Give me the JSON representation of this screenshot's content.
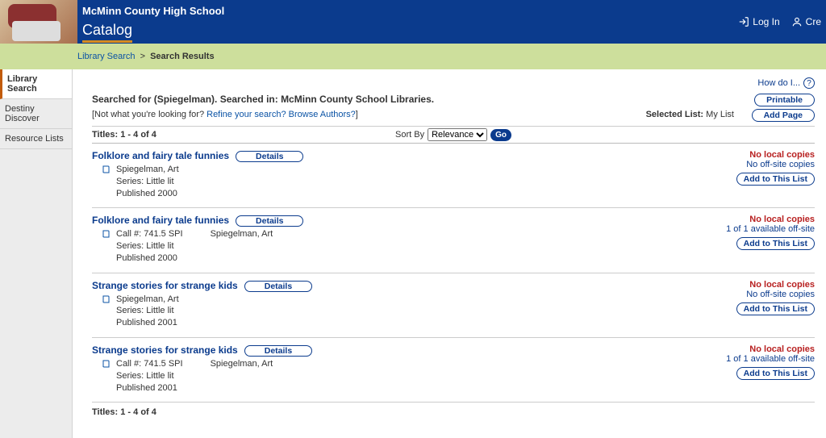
{
  "header": {
    "school_name": "McMinn County High School",
    "catalog_label": "Catalog",
    "login_label": "Log In",
    "create_label": "Cre"
  },
  "breadcrumb": {
    "library_search": "Library Search",
    "search_results": "Search Results"
  },
  "left_nav": {
    "items": [
      {
        "label": "Library Search",
        "active": true
      },
      {
        "label": "Destiny Discover",
        "active": false
      },
      {
        "label": "Resource Lists",
        "active": false
      }
    ]
  },
  "howto_label": "How do I...",
  "search_summary": "Searched for (Spiegelman). Searched in: McMinn County School Libraries.",
  "refine": {
    "prefix": "[Not what you're looking for? ",
    "refine_link": "Refine your search?",
    "browse_link": "Browse Authors?",
    "suffix": "]"
  },
  "printable_label": "Printable",
  "addpage_label": "Add Page",
  "selected_list_label": "Selected List:",
  "selected_list_value": "My List",
  "titles_count": "Titles: 1 - 4 of 4",
  "sort_label": "Sort By",
  "sort_value": "Relevance",
  "go_label": "Go",
  "details_label": "Details",
  "addlist_label": "Add to This List",
  "results": [
    {
      "title": "Folklore and fairy tale funnies",
      "author": "Spiegelman, Art",
      "call_no": "",
      "series": "Series: Little lit",
      "published": "Published 2000",
      "local": "No local copies",
      "offsite": "No off-site copies"
    },
    {
      "title": "Folklore and fairy tale funnies",
      "author": "Spiegelman, Art",
      "call_no": "Call #: 741.5 SPI",
      "series": "Series: Little lit",
      "published": "Published 2000",
      "local": "No local copies",
      "offsite": "1 of 1 available off-site"
    },
    {
      "title": "Strange stories for strange kids",
      "author": "Spiegelman, Art",
      "call_no": "",
      "series": "Series: Little lit",
      "published": "Published 2001",
      "local": "No local copies",
      "offsite": "No off-site copies"
    },
    {
      "title": "Strange stories for strange kids",
      "author": "Spiegelman, Art",
      "call_no": "Call #: 741.5 SPI",
      "series": "Series: Little lit",
      "published": "Published 2001",
      "local": "No local copies",
      "offsite": "1 of 1 available off-site"
    }
  ]
}
